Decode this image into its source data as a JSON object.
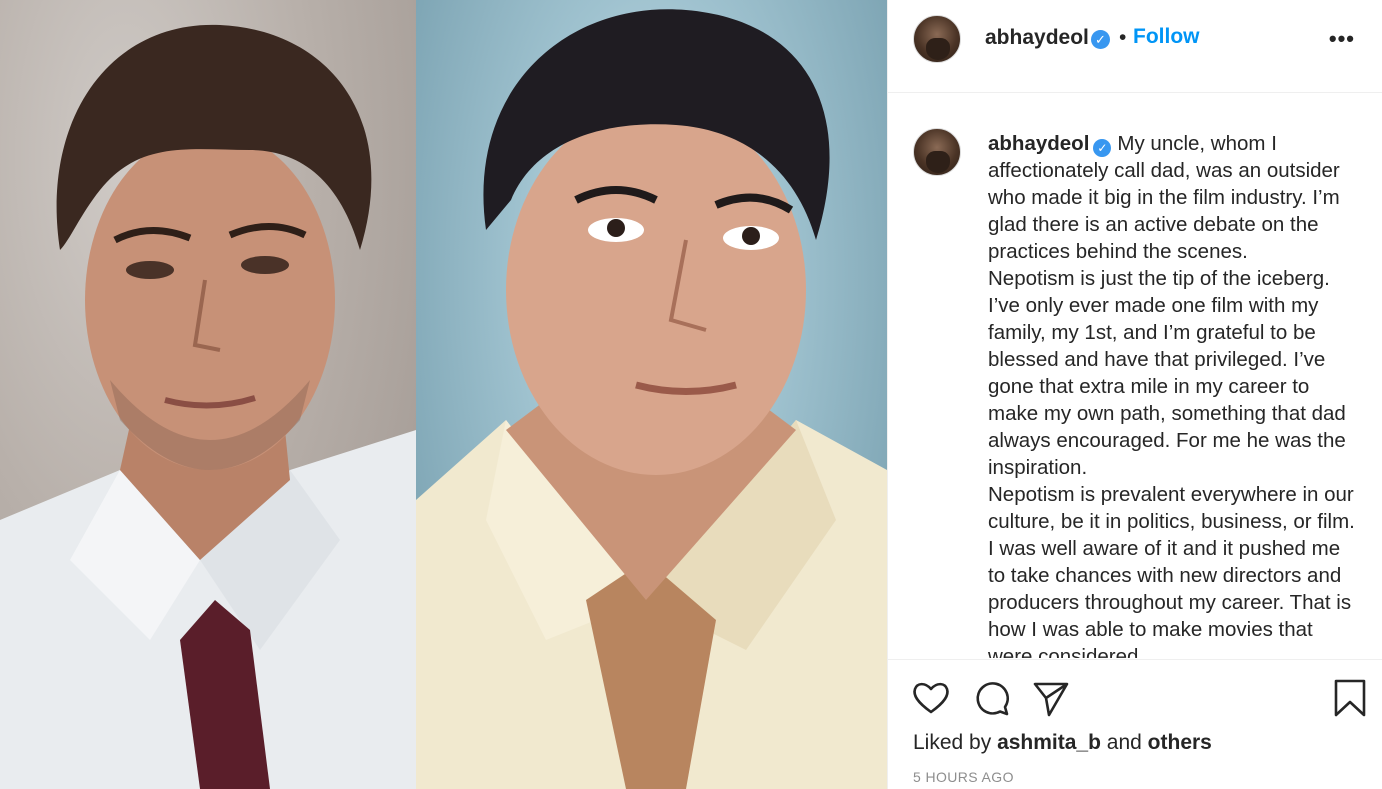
{
  "post": {
    "author": "abhaydeol",
    "follow_label": "Follow",
    "separator": "•",
    "more_label": "•••",
    "verified_mark": "✓"
  },
  "caption": {
    "author": "abhaydeol",
    "first_line": "My uncle, whom I affectionately call dad, was an outsider who made it big in the film industry. I’m glad there is an active debate on the practices behind the scenes.",
    "paragraph_2": "Nepotism is just the tip of the iceberg. I’ve only ever made one film with my family, my 1st, and I’m grateful to be blessed and have that privileged. I’ve gone that extra mile in my career to make my own path, something that dad always encouraged. For me he was the inspiration.",
    "paragraph_3": "Nepotism is prevalent everywhere in our culture, be it in politics, business, or film. I was well aware of it and it pushed me to take chances with new directors and producers throughout my career. That is how I was able to make movies that were considered"
  },
  "engagement": {
    "liked_by_prefix": "Liked by",
    "liked_by_user": "ashmita_b",
    "and_word": "and",
    "others_label": "others",
    "timestamp": "5 HOURS AGO"
  },
  "icons": [
    "heart-icon",
    "comment-icon",
    "share-icon",
    "bookmark-icon"
  ],
  "colors": {
    "link_blue": "#0095f6",
    "verified_blue": "#3897f0",
    "text": "#262626",
    "muted": "#8e8e8e",
    "border": "#efefef"
  }
}
